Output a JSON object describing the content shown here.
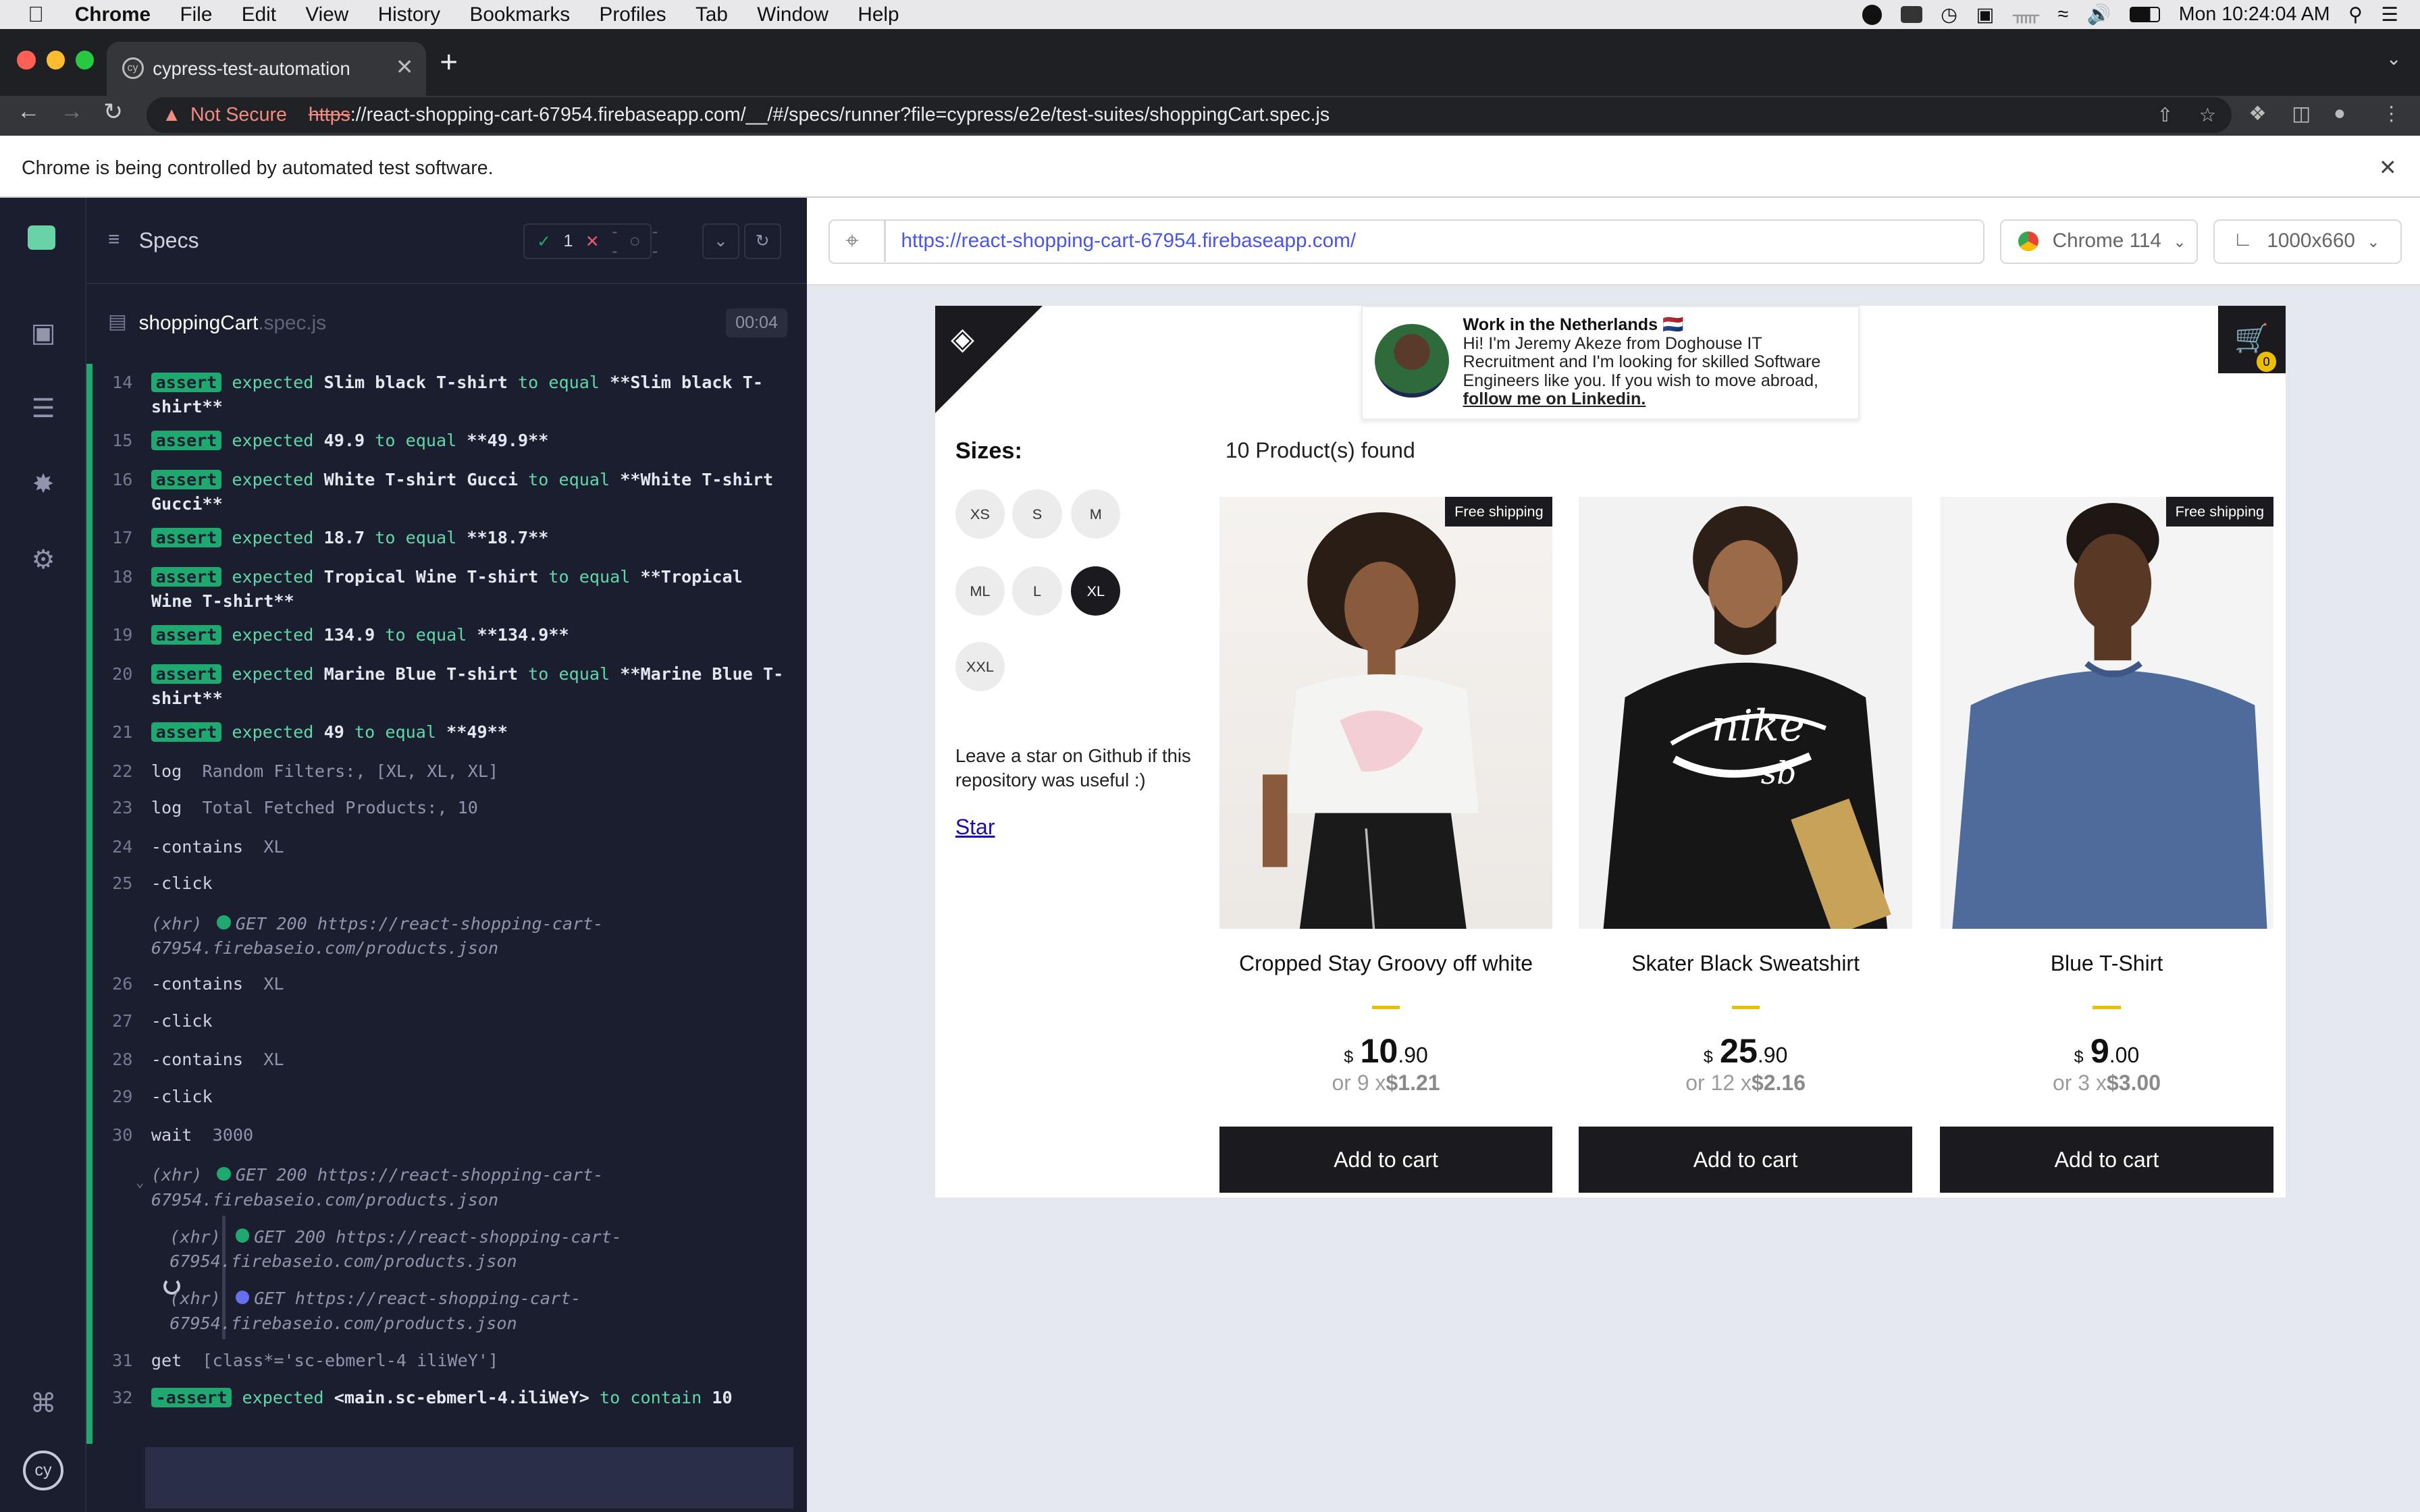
{
  "menubar": {
    "app": "Chrome",
    "items": [
      "File",
      "Edit",
      "View",
      "History",
      "Bookmarks",
      "Profiles",
      "Tab",
      "Window",
      "Help"
    ],
    "clock": "Mon 10:24:04 AM"
  },
  "browser": {
    "tab_title": "cypress-test-automation",
    "not_secure": "Not Secure",
    "url_scheme": "https",
    "url_rest": "://react-shopping-cart-67954.firebaseapp.com/__/#/specs/runner?file=cypress/e2e/test-suites/shoppingCart.spec.js",
    "infobar": "Chrome is being controlled by automated test software."
  },
  "reporter": {
    "title": "Specs",
    "passed": "1",
    "failed": "--",
    "pending": "--",
    "spec_name": "shoppingCart",
    "spec_ext": ".spec.js",
    "duration": "00:04",
    "commands": [
      {
        "num": "14",
        "badge": "assert",
        "text": "expected",
        "val": "Slim black T-shirt",
        "mid": "to equal",
        "val2": "**Slim black T-shirt**"
      },
      {
        "num": "15",
        "badge": "assert",
        "text": "expected",
        "val": "49.9",
        "mid": "to equal",
        "val2": "**49.9**"
      },
      {
        "num": "16",
        "badge": "assert",
        "text": "expected",
        "val": "White T-shirt Gucci",
        "mid": "to equal",
        "val2": "**White T-shirt Gucci**"
      },
      {
        "num": "17",
        "badge": "assert",
        "text": "expected",
        "val": "18.7",
        "mid": "to equal",
        "val2": "**18.7**"
      },
      {
        "num": "18",
        "badge": "assert",
        "text": "expected",
        "val": "Tropical Wine T-shirt",
        "mid": "to equal",
        "val2": "**Tropical Wine T-shirt**"
      },
      {
        "num": "19",
        "badge": "assert",
        "text": "expected",
        "val": "134.9",
        "mid": "to equal",
        "val2": "**134.9**"
      },
      {
        "num": "20",
        "badge": "assert",
        "text": "expected",
        "val": "Marine Blue T-shirt",
        "mid": "to equal",
        "val2": "**Marine Blue T-shirt**"
      },
      {
        "num": "21",
        "badge": "assert",
        "text": "expected",
        "val": "49",
        "mid": "to equal",
        "val2": "**49**"
      },
      {
        "num": "22",
        "name": "log",
        "msg": "Random Filters:, [XL, XL, XL]"
      },
      {
        "num": "23",
        "name": "log",
        "msg": "Total Fetched Products:, 10"
      },
      {
        "num": "24",
        "name": "-contains",
        "msg": "XL"
      },
      {
        "num": "25",
        "name": "-click",
        "msg": ""
      },
      {
        "xhr": "(xhr)",
        "msg": "GET 200 https://react-shopping-cart-67954.firebaseio.com/products.json"
      },
      {
        "num": "26",
        "name": "-contains",
        "msg": "XL"
      },
      {
        "num": "27",
        "name": "-click",
        "msg": ""
      },
      {
        "num": "28",
        "name": "-contains",
        "msg": "XL"
      },
      {
        "num": "29",
        "name": "-click",
        "msg": ""
      },
      {
        "num": "30",
        "name": "wait",
        "msg": "3000"
      },
      {
        "xhr": "(xhr)",
        "msg": "GET 200 https://react-shopping-cart-67954.firebaseio.com/products.json"
      },
      {
        "xhr": "(xhr)",
        "msg": "GET 200 https://react-shopping-cart-67954.firebaseio.com/products.json"
      },
      {
        "xhr": "(xhr)",
        "msg": "GET https://react-shopping-cart-67954.firebaseio.com/products.json"
      },
      {
        "num": "31",
        "name": "get",
        "msg": "[class*='sc-ebmerl-4 iliWeY']"
      },
      {
        "num": "32",
        "badge": "-assert",
        "text": "expected",
        "val": "<main.sc-ebmerl-4.iliWeY>",
        "mid": "to contain",
        "val2": "10"
      }
    ]
  },
  "runner": {
    "url": "https://react-shopping-cart-67954.firebaseapp.com/",
    "browser": "Chrome 114",
    "viewport": "1000x660"
  },
  "shop": {
    "promo_title": "Work in the Netherlands 🇳🇱",
    "promo_body": "Hi! I'm Jeremy Akeze from Doghouse IT Recruitment and I'm looking for skilled Software Engineers like you. If you wish to move abroad,",
    "promo_link": "follow me on Linkedin.",
    "cart_qty": "0",
    "sizes_title": "Sizes:",
    "sizes": [
      "XS",
      "S",
      "M",
      "ML",
      "L",
      "XL",
      "XXL"
    ],
    "selected_size": "XL",
    "leave_star": "Leave a star on Github if this repository was useful :)",
    "star_link": "Star",
    "found": "10 Product(s) found",
    "products": [
      {
        "title": "Cropped Stay Groovy off white",
        "badge": "Free shipping",
        "currency": "$",
        "int": "10",
        "cents": ".90",
        "inst_pre": "or 9 x",
        "inst_val": "$1.21",
        "button": "Add to cart"
      },
      {
        "title": "Skater Black Sweatshirt",
        "badge": "",
        "currency": "$",
        "int": "25",
        "cents": ".90",
        "inst_pre": "or 12 x",
        "inst_val": "$2.16",
        "button": "Add to cart"
      },
      {
        "title": "Blue T-Shirt",
        "badge": "Free shipping",
        "currency": "$",
        "int": "9",
        "cents": ".00",
        "inst_pre": "or 3 x",
        "inst_val": "$3.00",
        "button": "Add to cart"
      }
    ]
  }
}
